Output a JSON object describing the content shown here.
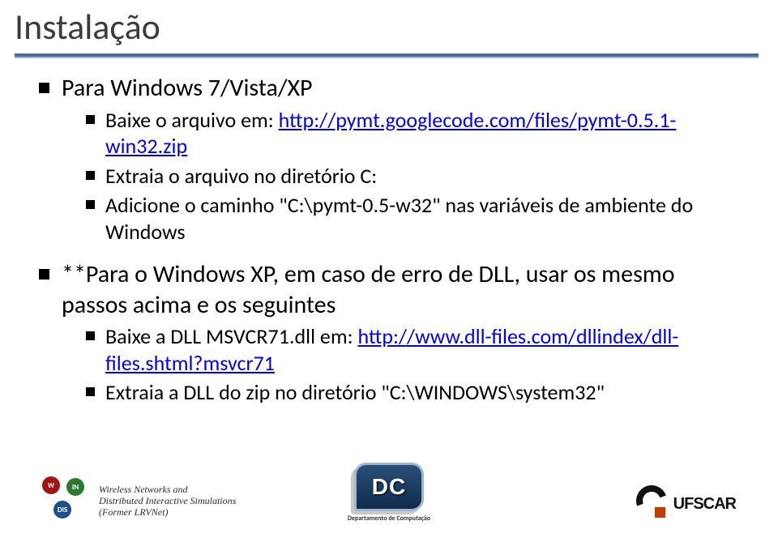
{
  "title": "Instalação",
  "bullets": {
    "b1": "Para Windows 7/Vista/XP",
    "b1_1_prefix": "Baixe o arquivo em: ",
    "b1_1_link": "http://pymt.googlecode.com/files/pymt-0.5.1-win32.zip",
    "b1_2": "Extraia o arquivo no diretório C:",
    "b1_3": "Adicione o caminho \"C:\\pymt-0.5-w32\" nas variáveis de ambiente do Windows",
    "b2": "**Para o Windows XP, em caso de erro de DLL, usar os mesmo passos acima e os seguintes",
    "b2_1_prefix": "Baixe a DLL MSVCR71.dll em: ",
    "b2_1_link": "http://www.dll-files.com/dllindex/dll-files.shtml?msvcr71",
    "b2_2": "Extraia a DLL do zip no diretório \"C:\\WINDOWS\\system32\""
  },
  "footer": {
    "windis_line1": "Wireless Networks and",
    "windis_line2": "Distributed Interactive Simulations",
    "windis_line3": "(Former LRVNet)",
    "dc_label": "DC",
    "dc_caption": "Departamento de Computação",
    "ufscar": "UFSCAR"
  }
}
